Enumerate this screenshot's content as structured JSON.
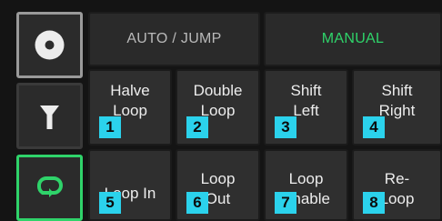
{
  "side_buttons": [
    {
      "icon": "disc-icon"
    },
    {
      "icon": "filter-icon"
    },
    {
      "icon": "loop-icon"
    }
  ],
  "modes": {
    "auto_jump": {
      "label": "AUTO / JUMP",
      "color": "#b9b9b9"
    },
    "manual": {
      "label": "MANUAL",
      "color": "#2fd36a"
    }
  },
  "pads": [
    {
      "label": "Halve\nLoop",
      "number": "1"
    },
    {
      "label": "Double\nLoop",
      "number": "2"
    },
    {
      "label": "Shift\nLeft",
      "number": "3"
    },
    {
      "label": "Shift\nRight",
      "number": "4"
    },
    {
      "label": "Loop In",
      "number": "5"
    },
    {
      "label": "Loop\nOut",
      "number": "6"
    },
    {
      "label": "Loop\nEnable",
      "number": "7"
    },
    {
      "label": "Re-\nLoop",
      "number": "8"
    }
  ],
  "colors": {
    "accent_green": "#2fd36a",
    "number_badge": "#2bd2ec"
  }
}
